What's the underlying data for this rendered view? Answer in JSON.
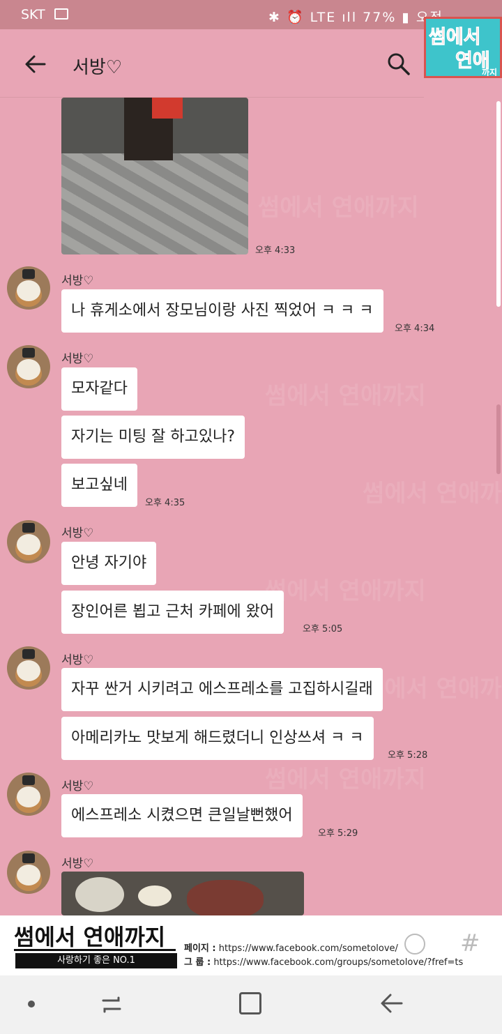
{
  "status_bar": {
    "carrier": "SKT",
    "right": "✱ ⏰ LTE ıll 77% ▮ 오전"
  },
  "badge": {
    "line1": "썸에서",
    "line2": "연애",
    "line3": "까지"
  },
  "header": {
    "title": "서방♡"
  },
  "watermark": "썸에서 연애까지",
  "messages": [
    {
      "type": "photo",
      "time": "오후 4:33"
    },
    {
      "sender": "서방♡",
      "bubbles": [
        "나 휴게소에서 장모님이랑 사진 찍었어 ㅋ ㅋ ㅋ"
      ],
      "time": "오후 4:34"
    },
    {
      "sender": "서방♡",
      "bubbles": [
        "모자같다",
        "자기는 미팅 잘 하고있나?",
        "보고싶네"
      ],
      "time": "오후 4:35"
    },
    {
      "sender": "서방♡",
      "bubbles": [
        "안녕 자기야",
        "장인어른 뵙고 근처 카페에 왔어"
      ],
      "time": "오후 5:05"
    },
    {
      "sender": "서방♡",
      "bubbles": [
        "자꾸 싼거 시키려고 에스프레소를 고집하시길래",
        "아메리카노 맛보게 해드렸더니 인상쓰셔 ㅋ ㅋ"
      ],
      "time": "오후 5:28"
    },
    {
      "sender": "서방♡",
      "bubbles": [
        "에스프레소 시켰으면 큰일날뻔했어"
      ],
      "time": "오후 5:29"
    },
    {
      "sender": "서방♡",
      "type": "photo"
    }
  ],
  "footer": {
    "brand": "썸에서 연애까지",
    "tagline": "사랑하기 좋은 NO.1",
    "page_label": "페이지 :",
    "page_url": "https://www.facebook.com/sometolove/",
    "group_label": "그    룹 :",
    "group_url": "https://www.facebook.com/groups/sometolove/?fref=ts"
  }
}
